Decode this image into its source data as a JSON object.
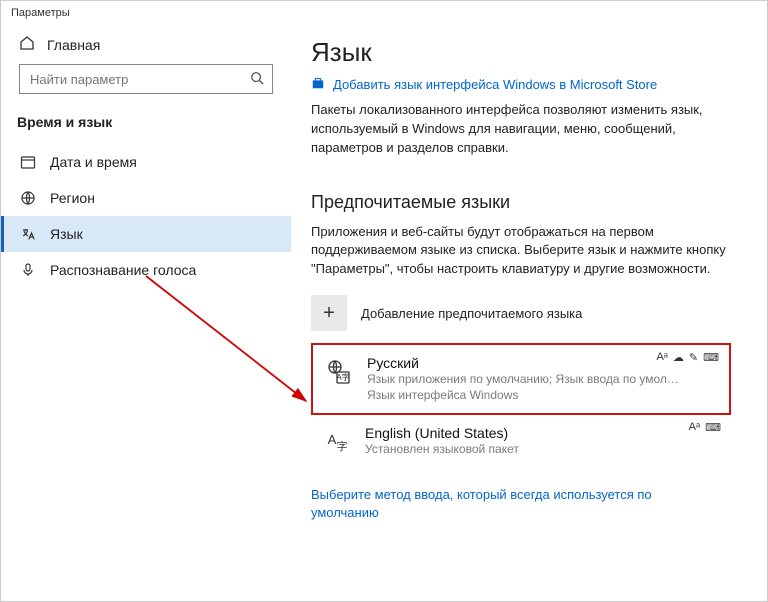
{
  "window_title": "Параметры",
  "sidebar": {
    "home": "Главная",
    "search_placeholder": "Найти параметр",
    "section": "Время и язык",
    "items": [
      {
        "label": "Дата и время"
      },
      {
        "label": "Регион"
      },
      {
        "label": "Язык"
      },
      {
        "label": "Распознавание голоса"
      }
    ]
  },
  "main": {
    "heading": "Язык",
    "store_link": "Добавить язык интерфейса Windows в Microsoft Store",
    "desc": "Пакеты локализованного интерфейса позволяют изменить язык, используемый в Windows для навигации, меню, сообщений, параметров и разделов справки.",
    "pref_heading": "Предпочитаемые языки",
    "pref_desc": "Приложения и веб-сайты будут отображаться на первом поддерживаемом языке из списка. Выберите язык и нажмите кнопку \"Параметры\", чтобы настроить клавиатуру и другие возможности.",
    "add_label": "Добавление предпочитаемого языка",
    "langs": [
      {
        "name": "Русский",
        "sub1": "Язык приложения по умолчанию; Язык ввода по умол…",
        "sub2": "Язык интерфейса Windows"
      },
      {
        "name": "English (United States)",
        "sub1": "Установлен языковой пакет",
        "sub2": ""
      }
    ],
    "bottom_link": "Выберите метод ввода, который всегда используется по умолчанию"
  }
}
